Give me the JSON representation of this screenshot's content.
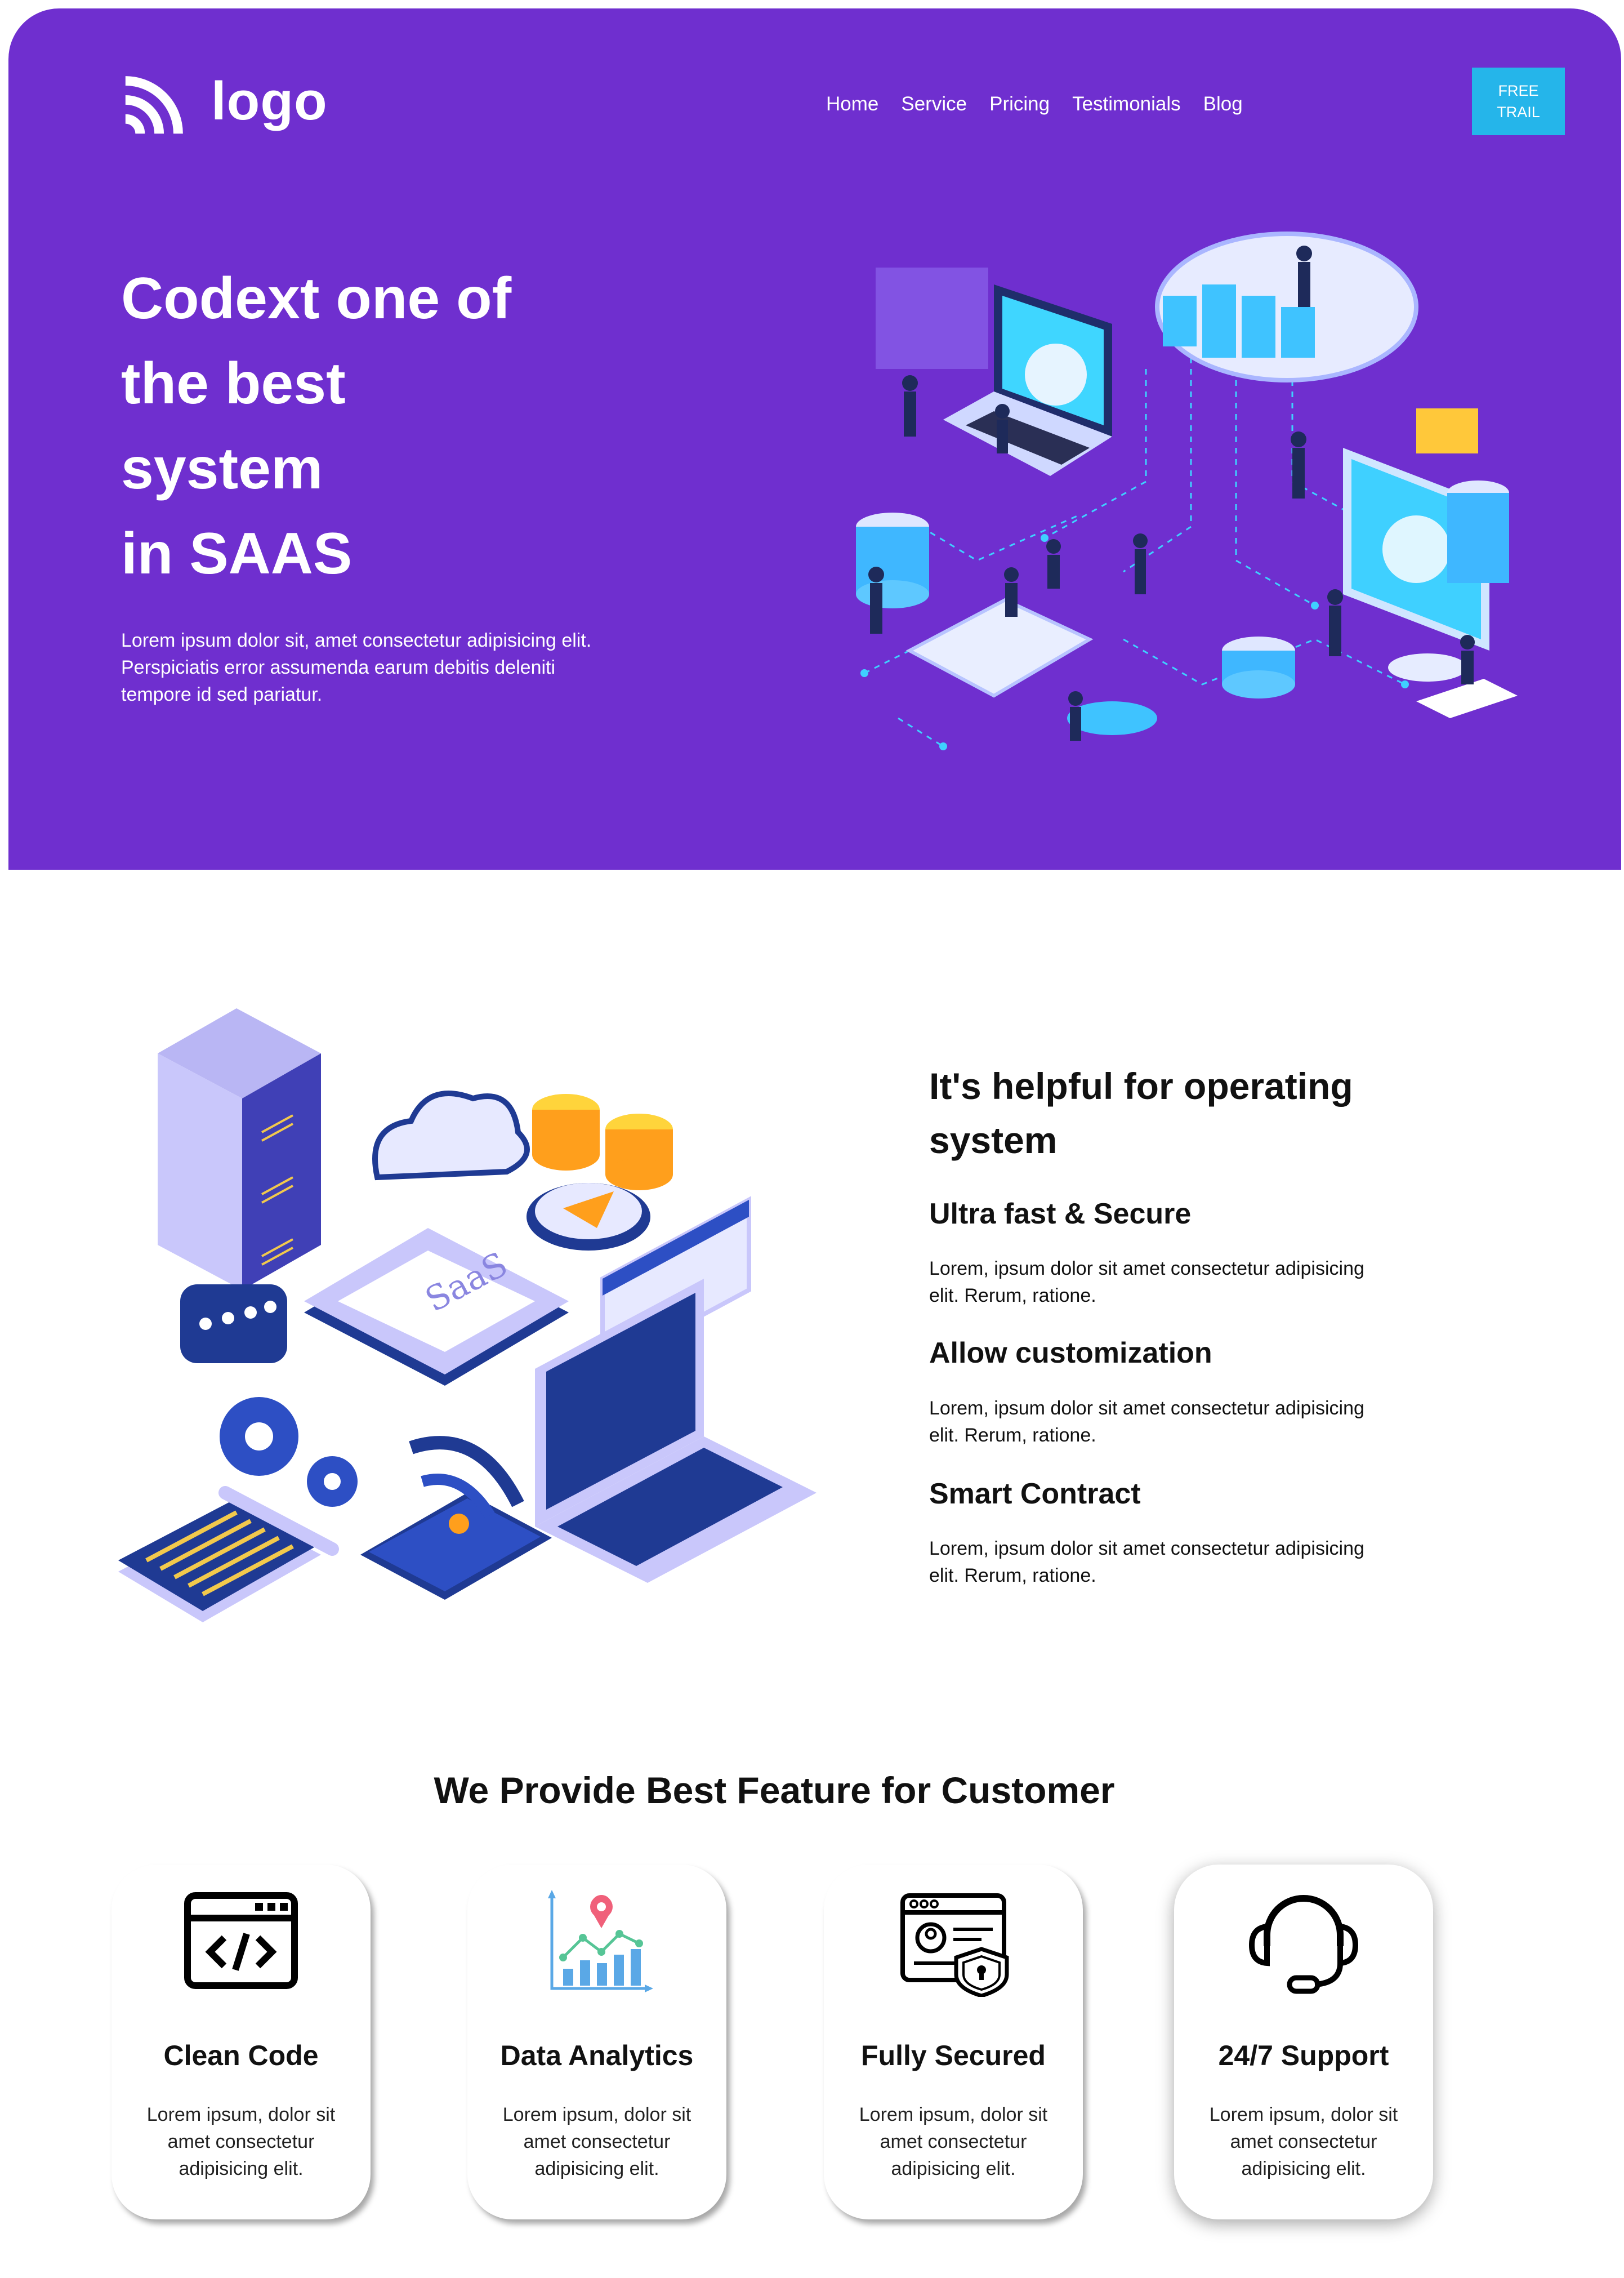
{
  "brand": {
    "logo_text": "logo"
  },
  "nav": {
    "items": [
      "Home",
      "Service",
      "Pricing",
      "Testimonials",
      "Blog"
    ],
    "cta_label": "FREE TRAIL"
  },
  "hero": {
    "title": "Codext one of\nthe best\nsystem\nin SAAS",
    "description": "Lorem ipsum dolor sit, amet consectetur adipisicing elit. Perspiciatis error assumenda earum debitis deleniti tempore id sed pariatur."
  },
  "features": {
    "title": "It's helpful for operating\nsystem",
    "items": [
      {
        "title": "Ultra fast & Secure",
        "description": "Lorem, ipsum dolor sit amet consectetur adipisicing elit. Rerum, ratione."
      },
      {
        "title": "Allow customization",
        "description": "Lorem, ipsum dolor sit amet consectetur adipisicing elit. Rerum, ratione."
      },
      {
        "title": "Smart Contract",
        "description": "Lorem, ipsum dolor sit amet consectetur adipisicing elit. Rerum, ratione."
      }
    ],
    "illustration_label": "SaaS"
  },
  "services": {
    "title": "We Provide Best Feature for Customer",
    "cards": [
      {
        "title": "Clean Code",
        "description": "Lorem ipsum, dolor sit amet consectetur adipisicing elit.",
        "icon": "code-window-icon"
      },
      {
        "title": "Data Analytics",
        "description": "Lorem ipsum, dolor sit amet consectetur adipisicing elit.",
        "icon": "analytics-chart-icon"
      },
      {
        "title": "Fully Secured",
        "description": "Lorem ipsum, dolor sit amet consectetur adipisicing elit.",
        "icon": "secure-profile-icon"
      },
      {
        "title": "24/7 Support",
        "description": "Lorem ipsum, dolor sit amet consectetur adipisicing elit.",
        "icon": "headset-icon"
      }
    ]
  },
  "colors": {
    "hero_bg": "#6f2fcf",
    "cta_bg": "#25b5ea",
    "text_dark": "#111111"
  }
}
